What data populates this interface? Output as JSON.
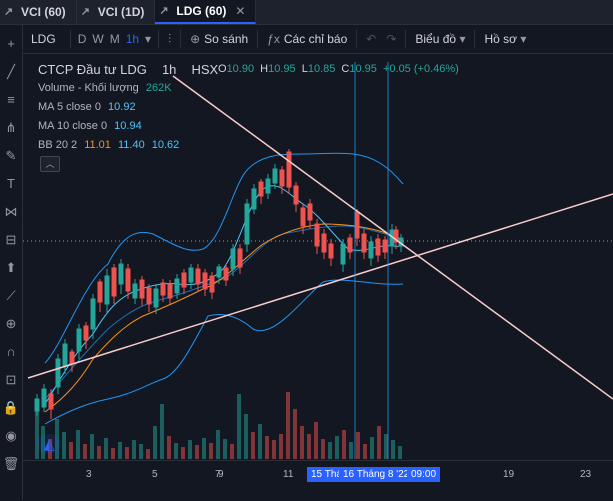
{
  "tabs": [
    {
      "label": "VCI (60)",
      "active": false
    },
    {
      "label": "VCI (1D)",
      "active": false
    },
    {
      "label": "LDG (60)",
      "active": true
    }
  ],
  "toolbar": {
    "symbol": "LDG",
    "intervals": [
      "D",
      "W",
      "M",
      "1h"
    ],
    "active_interval": "1h",
    "compare_label": "So sánh",
    "indicators_label": "Các chỉ báo",
    "chart_type_label": "Biểu đồ",
    "profile_label": "Hồ sơ"
  },
  "legend": {
    "name": "CTCP Đầu tư LDG",
    "interval": "1h",
    "exchange": "HSX",
    "volume_label": "Volume - Khối lượng",
    "volume_value": "262K",
    "ma5_label": "MA 5 close 0",
    "ma5_value": "10.92",
    "ma10_label": "MA 10 close 0",
    "ma10_value": "10.94",
    "bb_label": "BB 20 2",
    "bb_mid": "11.01",
    "bb_upper": "11.40",
    "bb_lower": "10.62"
  },
  "ohlc": {
    "o_label": "O",
    "o": "10.90",
    "h_label": "H",
    "h": "10.95",
    "l_label": "L",
    "l": "10.85",
    "c_label": "C",
    "c": "10.95",
    "change": "+0.05 (+0.46%)"
  },
  "xaxis": {
    "ticks": [
      "3",
      "5",
      "7",
      "9",
      "11",
      "19",
      "23"
    ],
    "highlight_left": "15 Thá",
    "highlight_main": "16 Tháng 8 '22",
    "highlight_time": "09:00"
  },
  "colors": {
    "up": "#26a69a",
    "down": "#ef5350",
    "accent": "#2962ff",
    "ma5": "#f7931a",
    "bb": "#2196f3"
  }
}
